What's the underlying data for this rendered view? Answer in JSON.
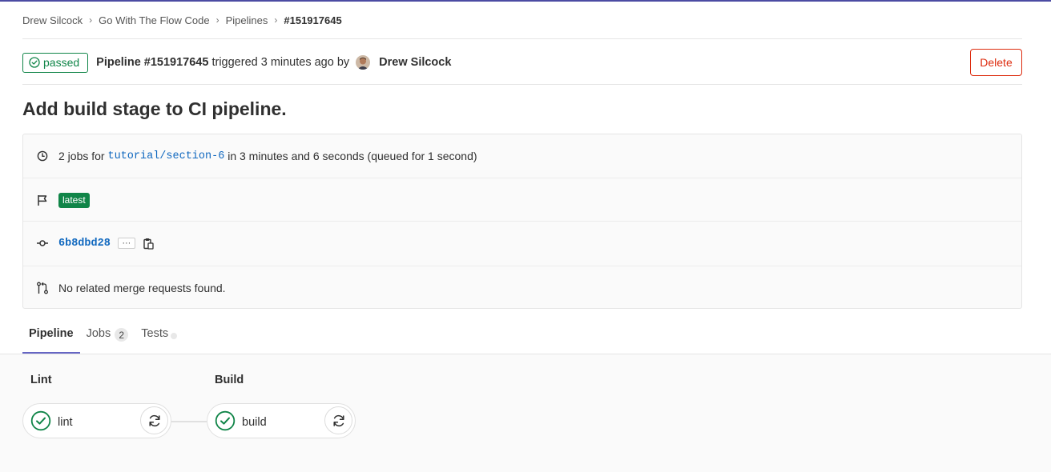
{
  "breadcrumb": {
    "items": [
      "Drew Silcock",
      "Go With The Flow Code",
      "Pipelines"
    ],
    "current": "#151917645",
    "separator": "›"
  },
  "pipeline_header": {
    "status": "passed",
    "pipeline_label": "Pipeline #151917645",
    "triggered_text": "triggered 3 minutes ago by",
    "author": "Drew Silcock",
    "delete_label": "Delete",
    "status_color": "#108548",
    "danger_color": "#dd2b0e"
  },
  "commit_title": "Add build stage to CI pipeline.",
  "info": {
    "jobs_prefix": "2 jobs for",
    "branch": "tutorial/section-6",
    "duration_text": "in 3 minutes and 6 seconds (queued for 1 second)",
    "latest_badge": "latest",
    "commit_sha": "6b8dbd28",
    "ellipsis": "···",
    "merge_requests": "No related merge requests found."
  },
  "tabs": [
    {
      "label": "Pipeline",
      "active": true
    },
    {
      "label": "Jobs",
      "count": "2"
    },
    {
      "label": "Tests"
    }
  ],
  "stages": [
    {
      "title": "Lint",
      "job": "lint",
      "status": "success"
    },
    {
      "title": "Build",
      "job": "build",
      "status": "success"
    }
  ],
  "icons": {
    "status": "check-circle-icon",
    "clock": "clock-icon",
    "flag": "flag-icon",
    "commit": "commit-icon",
    "copy": "clipboard-icon",
    "merge_request": "merge-request-icon",
    "retry": "retry-icon"
  }
}
